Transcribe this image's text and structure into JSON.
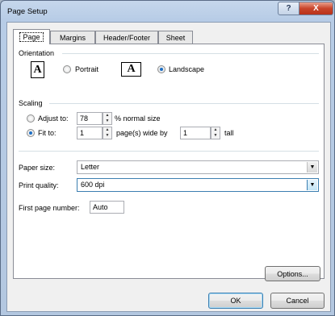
{
  "window": {
    "title": "Page Setup",
    "help_glyph": "?",
    "close_glyph": "X"
  },
  "tabs": [
    {
      "label": "Page",
      "active": true
    },
    {
      "label": "Margins",
      "active": false
    },
    {
      "label": "Header/Footer",
      "active": false
    },
    {
      "label": "Sheet",
      "active": false
    }
  ],
  "orientation": {
    "group_label": "Orientation",
    "portrait_label": "Portrait",
    "landscape_label": "Landscape",
    "portrait_icon_letter": "A",
    "landscape_icon_letter": "A",
    "selected": "landscape"
  },
  "scaling": {
    "group_label": "Scaling",
    "adjust_label": "Adjust to:",
    "adjust_value": "78",
    "adjust_suffix": "% normal size",
    "fit_label": "Fit to:",
    "fit_wide_value": "1",
    "fit_wide_suffix": "page(s) wide by",
    "fit_tall_value": "1",
    "fit_tall_suffix": "tall",
    "selected": "fit"
  },
  "paper_size": {
    "label": "Paper size:",
    "value": "Letter"
  },
  "print_quality": {
    "label": "Print quality:",
    "value": "600 dpi"
  },
  "first_page_number": {
    "label": "First page number:",
    "value": "Auto"
  },
  "buttons": {
    "options": "Options...",
    "ok": "OK",
    "cancel": "Cancel"
  },
  "colors": {
    "accent": "#3c7fb1",
    "close_red": "#c9452b",
    "radio_dot": "#1d6fc5"
  }
}
